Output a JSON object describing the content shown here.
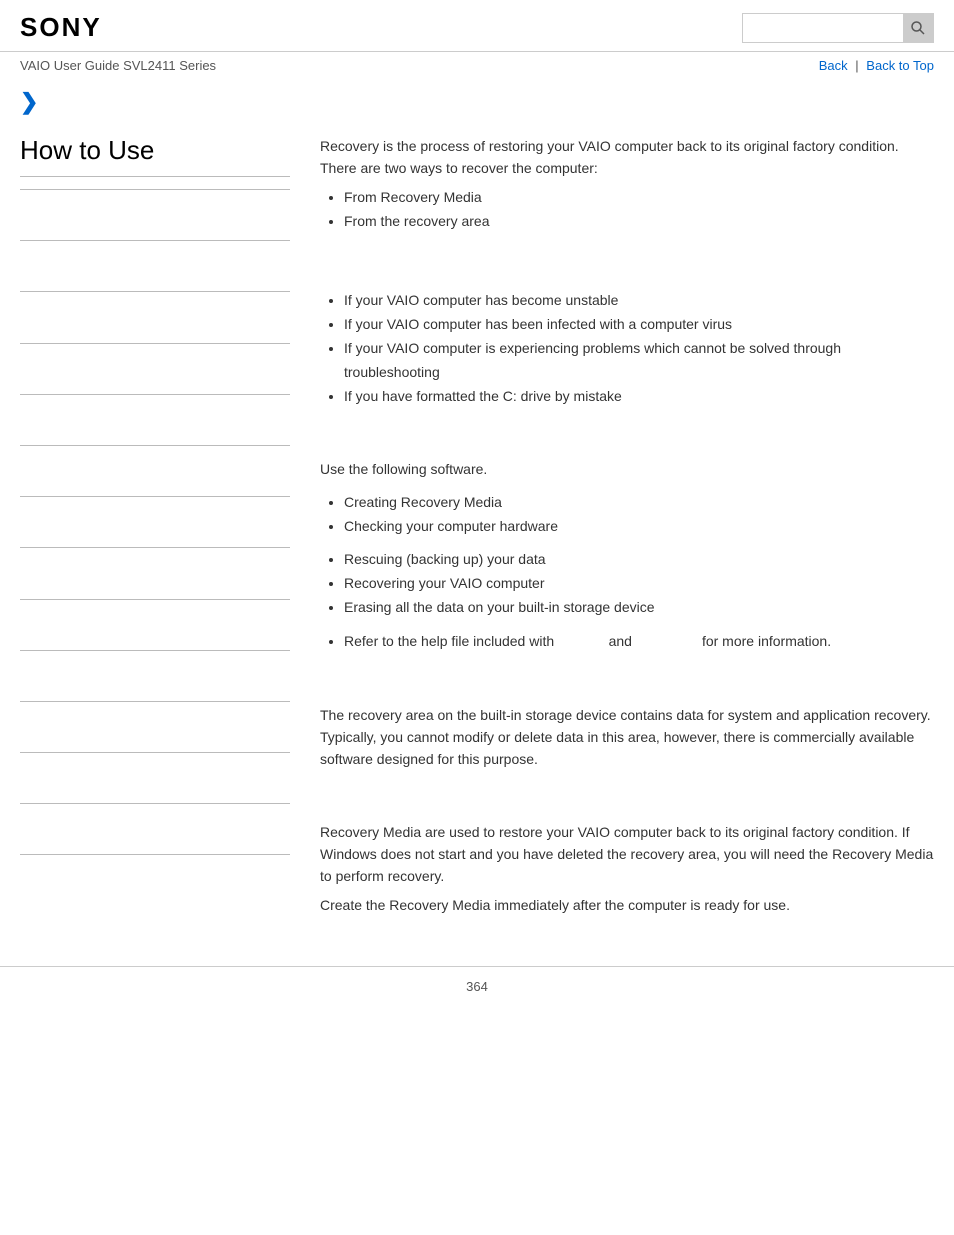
{
  "header": {
    "logo": "SONY",
    "search_placeholder": ""
  },
  "sub_header": {
    "guide_title": "VAIO User Guide SVL2411 Series",
    "back_label": "Back",
    "back_to_top_label": "Back to Top"
  },
  "breadcrumb": {
    "arrow": "❯"
  },
  "sidebar": {
    "title": "How to Use",
    "items": [
      "",
      "",
      "",
      "",
      "",
      "",
      "",
      "",
      "",
      "",
      "",
      "",
      "",
      ""
    ]
  },
  "content": {
    "section1": {
      "text1": "Recovery is the process of restoring your VAIO computer back to its original factory condition.",
      "text2": "There are two ways to recover the computer:",
      "list": [
        "From Recovery Media",
        "From the recovery area"
      ]
    },
    "section2": {
      "list": [
        "If your VAIO computer has become unstable",
        "If your VAIO computer has been infected with a computer virus",
        "If your VAIO computer is experiencing problems which cannot be solved through troubleshooting",
        "If you have formatted the C: drive by mistake"
      ]
    },
    "section3": {
      "text": "Use the following software.",
      "list1": [
        "Creating Recovery Media",
        "Checking your computer hardware"
      ],
      "list2": [
        "Rescuing (backing up) your data",
        "Recovering your VAIO computer",
        "Erasing all the data on your built-in storage device"
      ],
      "list3": [
        "Refer to the help file included with                    and                    for more information."
      ]
    },
    "section4": {
      "text": "The recovery area on the built-in storage device contains data for system and application recovery. Typically, you cannot modify or delete data in this area, however, there is commercially available software designed for this purpose."
    },
    "section5": {
      "text1": "Recovery Media are used to restore your VAIO computer back to its original factory condition. If Windows does not start and you have deleted the recovery area, you will need the Recovery Media to perform recovery.",
      "text2": "Create the Recovery Media immediately after the computer is ready for use."
    }
  },
  "footer": {
    "page_number": "364"
  },
  "icons": {
    "search": "🔍",
    "chevron_right": "❯"
  }
}
